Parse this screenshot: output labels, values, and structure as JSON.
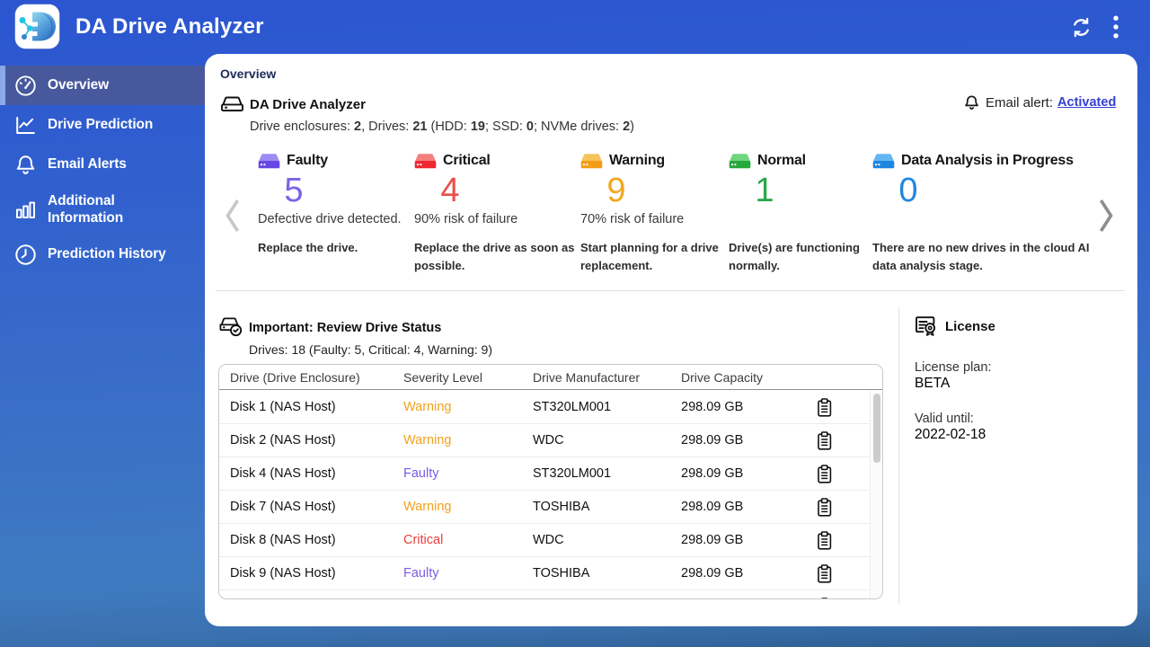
{
  "app": {
    "title": "DA Drive Analyzer"
  },
  "topbar": {
    "refresh_icon": "sync",
    "menu_icon": "kebab"
  },
  "sidebar": {
    "items": [
      {
        "label": "Overview",
        "icon": "gauge-icon",
        "active": true
      },
      {
        "label": "Drive Prediction",
        "icon": "line-chart-icon",
        "active": false
      },
      {
        "label": "Email Alerts",
        "icon": "bell-icon",
        "active": false
      },
      {
        "label": "Additional Information",
        "icon": "bar-chart-icon",
        "active": false
      },
      {
        "label": "Prediction History",
        "icon": "clock-icon",
        "active": false
      }
    ]
  },
  "content": {
    "page_title": "Overview",
    "summary": {
      "icon": "drive-icon",
      "title": "DA Drive Analyzer",
      "detail_segments": [
        {
          "t": "Drive enclosures: ",
          "b": false
        },
        {
          "t": "2",
          "b": true
        },
        {
          "t": ", Drives: ",
          "b": false
        },
        {
          "t": "21",
          "b": true
        },
        {
          "t": " (HDD: ",
          "b": false
        },
        {
          "t": "19",
          "b": true
        },
        {
          "t": "; SSD: ",
          "b": false
        },
        {
          "t": "0",
          "b": true
        },
        {
          "t": "; NVMe drives: ",
          "b": false
        },
        {
          "t": "2",
          "b": true
        },
        {
          "t": ")",
          "b": false
        }
      ]
    },
    "email_alert": {
      "icon": "bell-icon",
      "label": "Email alert:",
      "link": "Activated"
    },
    "status_cards": [
      {
        "label": "Faulty",
        "count": "5",
        "count_color": "#7a63e8",
        "icon_top": "#9b8cf2",
        "icon_front": "#6747e4",
        "line1": "Defective drive detected.",
        "line2": "Replace the drive."
      },
      {
        "label": "Critical",
        "count": "4",
        "count_color": "#e85149",
        "icon_top": "#f47f7f",
        "icon_front": "#ee2832",
        "line1": "90% risk of failure",
        "line2": "Replace the drive as soon as possible."
      },
      {
        "label": "Warning",
        "count": "9",
        "count_color": "#f2a71f",
        "icon_top": "#f6c25a",
        "icon_front": "#f39d16",
        "line1": "70% risk of failure",
        "line2": "Start planning for a drive replacement."
      },
      {
        "label": "Normal",
        "count": "1",
        "count_color": "#2ba84a",
        "icon_top": "#6fd57f",
        "icon_front": "#26a83d",
        "line1": "",
        "line2": "Drive(s) are functioning normally."
      },
      {
        "label": "Data Analysis in Progress",
        "count": "0",
        "count_color": "#2186e0",
        "icon_top": "#63b7f0",
        "icon_front": "#1d87e0",
        "line1": "",
        "line2": "There are no new drives in the cloud AI data analysis stage."
      }
    ],
    "drive_status": {
      "icon": "drive-check-icon",
      "title": "Important: Review Drive Status",
      "subtitle": "Drives: 18 (Faulty: 5, Critical: 4, Warning: 9)",
      "table": {
        "columns": [
          "Drive (Drive Enclosure)",
          "Severity Level",
          "Drive Manufacturer",
          "Drive Capacity"
        ],
        "rows": [
          {
            "drive": "Disk 1 (NAS Host)",
            "severity": "Warning",
            "severity_color": "#f2a21c",
            "manufacturer": "ST320LM001",
            "capacity": "298.09 GB"
          },
          {
            "drive": "Disk 2 (NAS Host)",
            "severity": "Warning",
            "severity_color": "#f2a21c",
            "manufacturer": "WDC",
            "capacity": "298.09 GB"
          },
          {
            "drive": "Disk 4 (NAS Host)",
            "severity": "Faulty",
            "severity_color": "#7a5ce6",
            "manufacturer": "ST320LM001",
            "capacity": "298.09 GB"
          },
          {
            "drive": "Disk 7 (NAS Host)",
            "severity": "Warning",
            "severity_color": "#f2a21c",
            "manufacturer": "TOSHIBA",
            "capacity": "298.09 GB"
          },
          {
            "drive": "Disk 8 (NAS Host)",
            "severity": "Critical",
            "severity_color": "#e8403c",
            "manufacturer": "WDC",
            "capacity": "298.09 GB"
          },
          {
            "drive": "Disk 9 (NAS Host)",
            "severity": "Faulty",
            "severity_color": "#7a5ce6",
            "manufacturer": "TOSHIBA",
            "capacity": "298.09 GB"
          }
        ],
        "overflow_row_visible": true
      }
    },
    "license": {
      "icon": "license-icon",
      "title": "License",
      "plan_label": "License plan:",
      "plan_value": "BETA",
      "valid_label": "Valid until:",
      "valid_value": "2022-02-18"
    }
  },
  "colors": {
    "topbar_blue": "#2b55d1",
    "active_item": "#47599c",
    "link": "#3440d4"
  }
}
